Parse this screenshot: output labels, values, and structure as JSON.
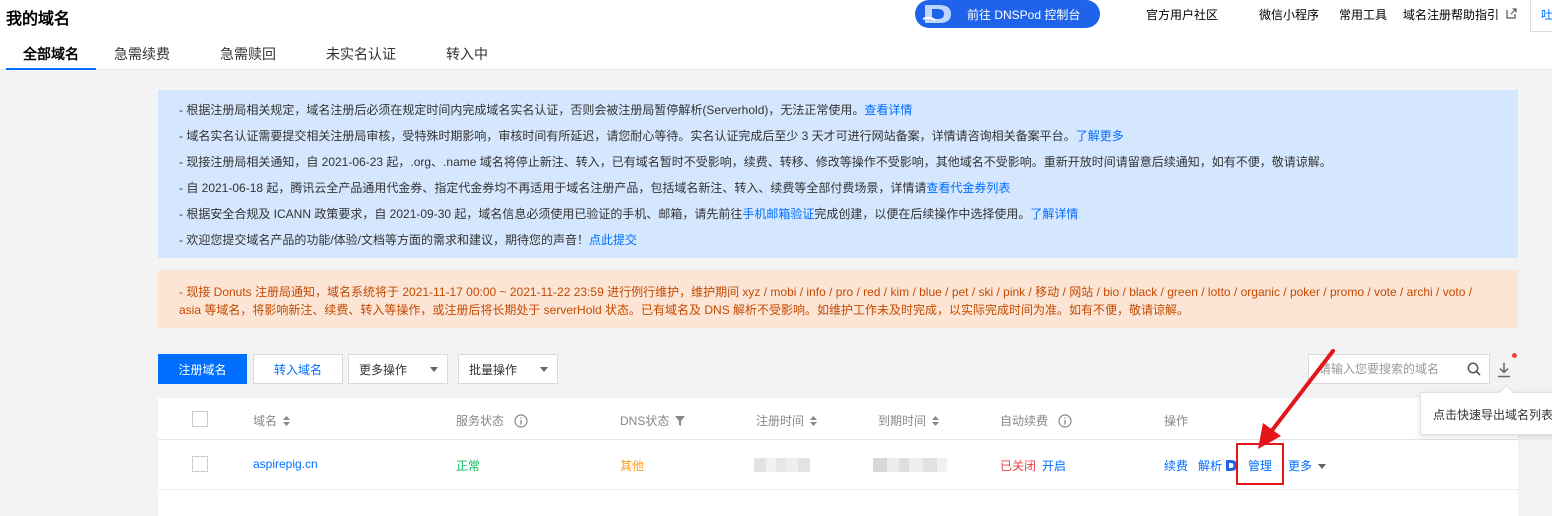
{
  "header": {
    "title": "我的域名",
    "dnspod_button": "前往 DNSPod 控制台",
    "links": [
      "官方用户社区",
      "微信小程序",
      "常用工具",
      "域名注册帮助指引"
    ],
    "edge_tab": "吐"
  },
  "tabs": [
    "全部域名",
    "急需续费",
    "急需赎回",
    "未实名认证",
    "转入中"
  ],
  "notices": {
    "blue": [
      {
        "text": "- 根据注册局相关规定，域名注册后必须在规定时间内完成域名实名认证，否则会被注册局暂停解析(Serverhold)，无法正常使用。",
        "link": "查看详情"
      },
      {
        "text": "- 域名实名认证需要提交相关注册局审核，受特殊时期影响，审核时间有所延迟，请您耐心等待。实名认证完成后至少 3 天才可进行网站备案，详情请咨询相关备案平台。",
        "link": "了解更多"
      },
      {
        "text": "- 现接注册局相关通知，自 2021-06-23 起，.org、.name 域名将停止新注、转入，已有域名暂时不受影响，续费、转移、修改等操作不受影响，其他域名不受影响。重新开放时间请留意后续通知，如有不便，敬请谅解。",
        "link": ""
      },
      {
        "text": "- 自 2021-06-18 起，腾讯云全产品通用代金券、指定代金券均不再适用于域名注册产品，包括域名新注、转入、续费等全部付费场景，详情请",
        "link": "查看代金券列表"
      },
      {
        "text": "- 根据安全合规及 ICANN 政策要求，自 2021-09-30 起，域名信息必须使用已验证的手机、邮箱，请先前往",
        "link": "手机邮箱验证",
        "text_after": "完成创建，以便在后续操作中选择使用。",
        "link2": "了解详情"
      },
      {
        "text": "- 欢迎您提交域名产品的功能/体验/文档等方面的需求和建议，期待您的声音！",
        "link": "点此提交"
      }
    ],
    "orange_line1": "- 现接 Donuts 注册局通知，域名系统将于 2021-11-17 00:00 ~ 2021-11-22 23:59 进行例行维护，维护期间 xyz / mobi / info / pro / red / kim / blue / pet / ski / pink / 移动 / 网站 / bio / black / green / lotto / organic / poker / promo / vote / archi / voto /",
    "orange_line2": "asia 等域名，将影响新注、续费、转入等操作，或注册后将长期处于 serverHold 状态。已有域名及 DNS 解析不受影响。如维护工作未及时完成，以实际完成时间为准。如有不便，敬请谅解。"
  },
  "toolbar": {
    "register": "注册域名",
    "transfer": "转入域名",
    "more_ops": "更多操作",
    "batch_ops": "批量操作",
    "search_placeholder": "请输入您要搜索的域名",
    "tooltip": "点击快速导出域名列表"
  },
  "table": {
    "headers": {
      "domain": "域名",
      "service_status": "服务状态",
      "dns_status": "DNS状态",
      "reg_time": "注册时间",
      "expire_time": "到期时间",
      "auto_renew": "自动续费",
      "actions": "操作"
    },
    "rows": [
      {
        "domain": "aspirepig.cn",
        "service_status": "正常",
        "dns_status": "其他",
        "auto_renew": "已关闭",
        "auto_renew_action": "开启",
        "actions": {
          "renew": "续费",
          "resolve": "解析",
          "manage": "管理",
          "more": "更多"
        }
      }
    ]
  },
  "colors": {
    "primary": "#006eff",
    "success": "#0abf5b",
    "warning": "#ff9c19",
    "danger": "#e54545",
    "annotation": "#e5161b"
  }
}
